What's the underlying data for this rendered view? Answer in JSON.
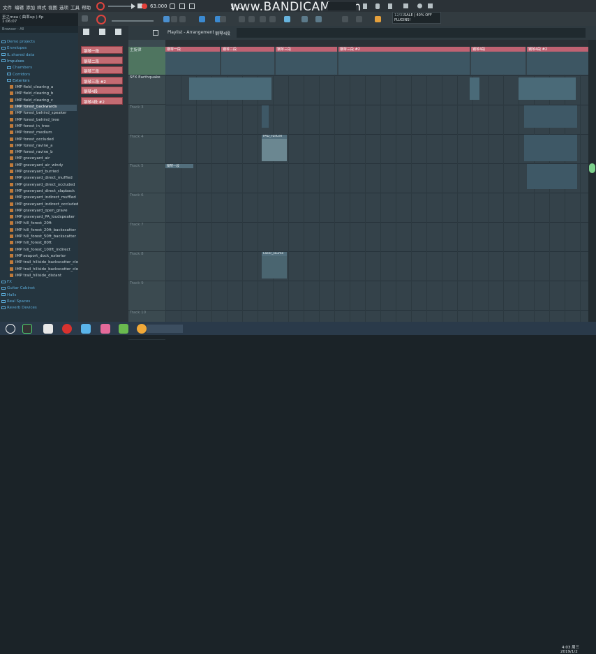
{
  "menubar": {
    "items": [
      "文件",
      "编辑",
      "添加",
      "样式",
      "视图",
      "选项",
      "工具",
      "帮助"
    ],
    "tempo": "63.000",
    "watermark": "www.BANDICAM.com",
    "timecode": "1:0"
  },
  "project": {
    "title": "至之mea ( 曲率up ).flp",
    "time": "1:06:07"
  },
  "hint": {
    "date": "12/31",
    "line1": "SALE | 40% OFF",
    "line2": "PLUGINS!"
  },
  "browser": {
    "header": "Browser - All",
    "items": [
      {
        "label": "Demo projects",
        "kind": "folder"
      },
      {
        "label": "Envelopes",
        "kind": "folder"
      },
      {
        "label": "IL shared data",
        "kind": "folder"
      },
      {
        "label": "Impulses",
        "kind": "folder-open"
      },
      {
        "label": "Chambers",
        "kind": "folder"
      },
      {
        "label": "Corridors",
        "kind": "folder"
      },
      {
        "label": "Exteriors",
        "kind": "folder-open"
      },
      {
        "label": "IMP field_clearing_a",
        "kind": "file"
      },
      {
        "label": "IMP field_clearing_b",
        "kind": "file"
      },
      {
        "label": "IMP field_clearing_c",
        "kind": "file"
      },
      {
        "label": "IMP forest_backwards",
        "kind": "file-selected"
      },
      {
        "label": "IMP forest_behind_speaker",
        "kind": "file"
      },
      {
        "label": "IMP forest_behind_tree",
        "kind": "file"
      },
      {
        "label": "IMP forest_in_tree",
        "kind": "file"
      },
      {
        "label": "IMP forest_medium",
        "kind": "file"
      },
      {
        "label": "IMP forest_occluded",
        "kind": "file"
      },
      {
        "label": "IMP forest_ravine_a",
        "kind": "file"
      },
      {
        "label": "IMP forest_ravine_b",
        "kind": "file"
      },
      {
        "label": "IMP graveyard_air",
        "kind": "file"
      },
      {
        "label": "IMP graveyard_air_windy",
        "kind": "file"
      },
      {
        "label": "IMP graveyard_burried",
        "kind": "file"
      },
      {
        "label": "IMP graveyard_direct_muffled",
        "kind": "file"
      },
      {
        "label": "IMP graveyard_direct_occluded",
        "kind": "file"
      },
      {
        "label": "IMP graveyard_direct_slapback",
        "kind": "file"
      },
      {
        "label": "IMP graveyard_indirect_muffled",
        "kind": "file"
      },
      {
        "label": "IMP graveyard_indirect_occluded",
        "kind": "file"
      },
      {
        "label": "IMP graveyard_open_grave",
        "kind": "file"
      },
      {
        "label": "IMP graveyard_PA_loudspeaker",
        "kind": "file"
      },
      {
        "label": "IMP hill_forest_20ft",
        "kind": "file"
      },
      {
        "label": "IMP hill_forest_20ft_backscatter",
        "kind": "file"
      },
      {
        "label": "IMP hill_forest_50ft_backscatter",
        "kind": "file"
      },
      {
        "label": "IMP hill_forest_80ft",
        "kind": "file"
      },
      {
        "label": "IMP hill_forest_100ft_indirect",
        "kind": "file"
      },
      {
        "label": "IMP seaport_dock_exterior",
        "kind": "file"
      },
      {
        "label": "IMP trail_hillside_backscatter_close_A",
        "kind": "file"
      },
      {
        "label": "IMP trail_hillside_backscatter_close_B",
        "kind": "file"
      },
      {
        "label": "IMP trail_hillside_distant",
        "kind": "file"
      },
      {
        "label": "FX",
        "kind": "folder"
      },
      {
        "label": "Guitar Cabinet",
        "kind": "folder"
      },
      {
        "label": "Halls",
        "kind": "folder"
      },
      {
        "label": "Real Spaces",
        "kind": "folder"
      },
      {
        "label": "Reverb Devices",
        "kind": "folder"
      }
    ]
  },
  "patterns": [
    "钢琴一段",
    "钢琴二段",
    "钢琴三段",
    "钢琴三段 #2",
    "钢琴4段",
    "钢琴4段 #2"
  ],
  "playlist": {
    "breadcrumb": "Playlist - Arrangement",
    "pattern": "钢琴4段",
    "tracks": [
      "主旋律",
      "SFX Earthquake",
      "Track 3",
      "Track 4",
      "Track 5",
      "Track 6",
      "Track 7",
      "Track 8",
      "Track 9",
      "Track 10"
    ],
    "clips": {
      "top": [
        "钢琴一段",
        "钢琴二段",
        "钢琴三段",
        "钢琴三段 #2",
        "钢琴4段",
        "钢琴4段 #2"
      ],
      "pad": "PAD_FullCell",
      "track5": "钢琴一段",
      "track8": "Laser_sLume"
    }
  },
  "taskbar": {
    "time": "4:03 周三",
    "date": "2019/1/2"
  }
}
